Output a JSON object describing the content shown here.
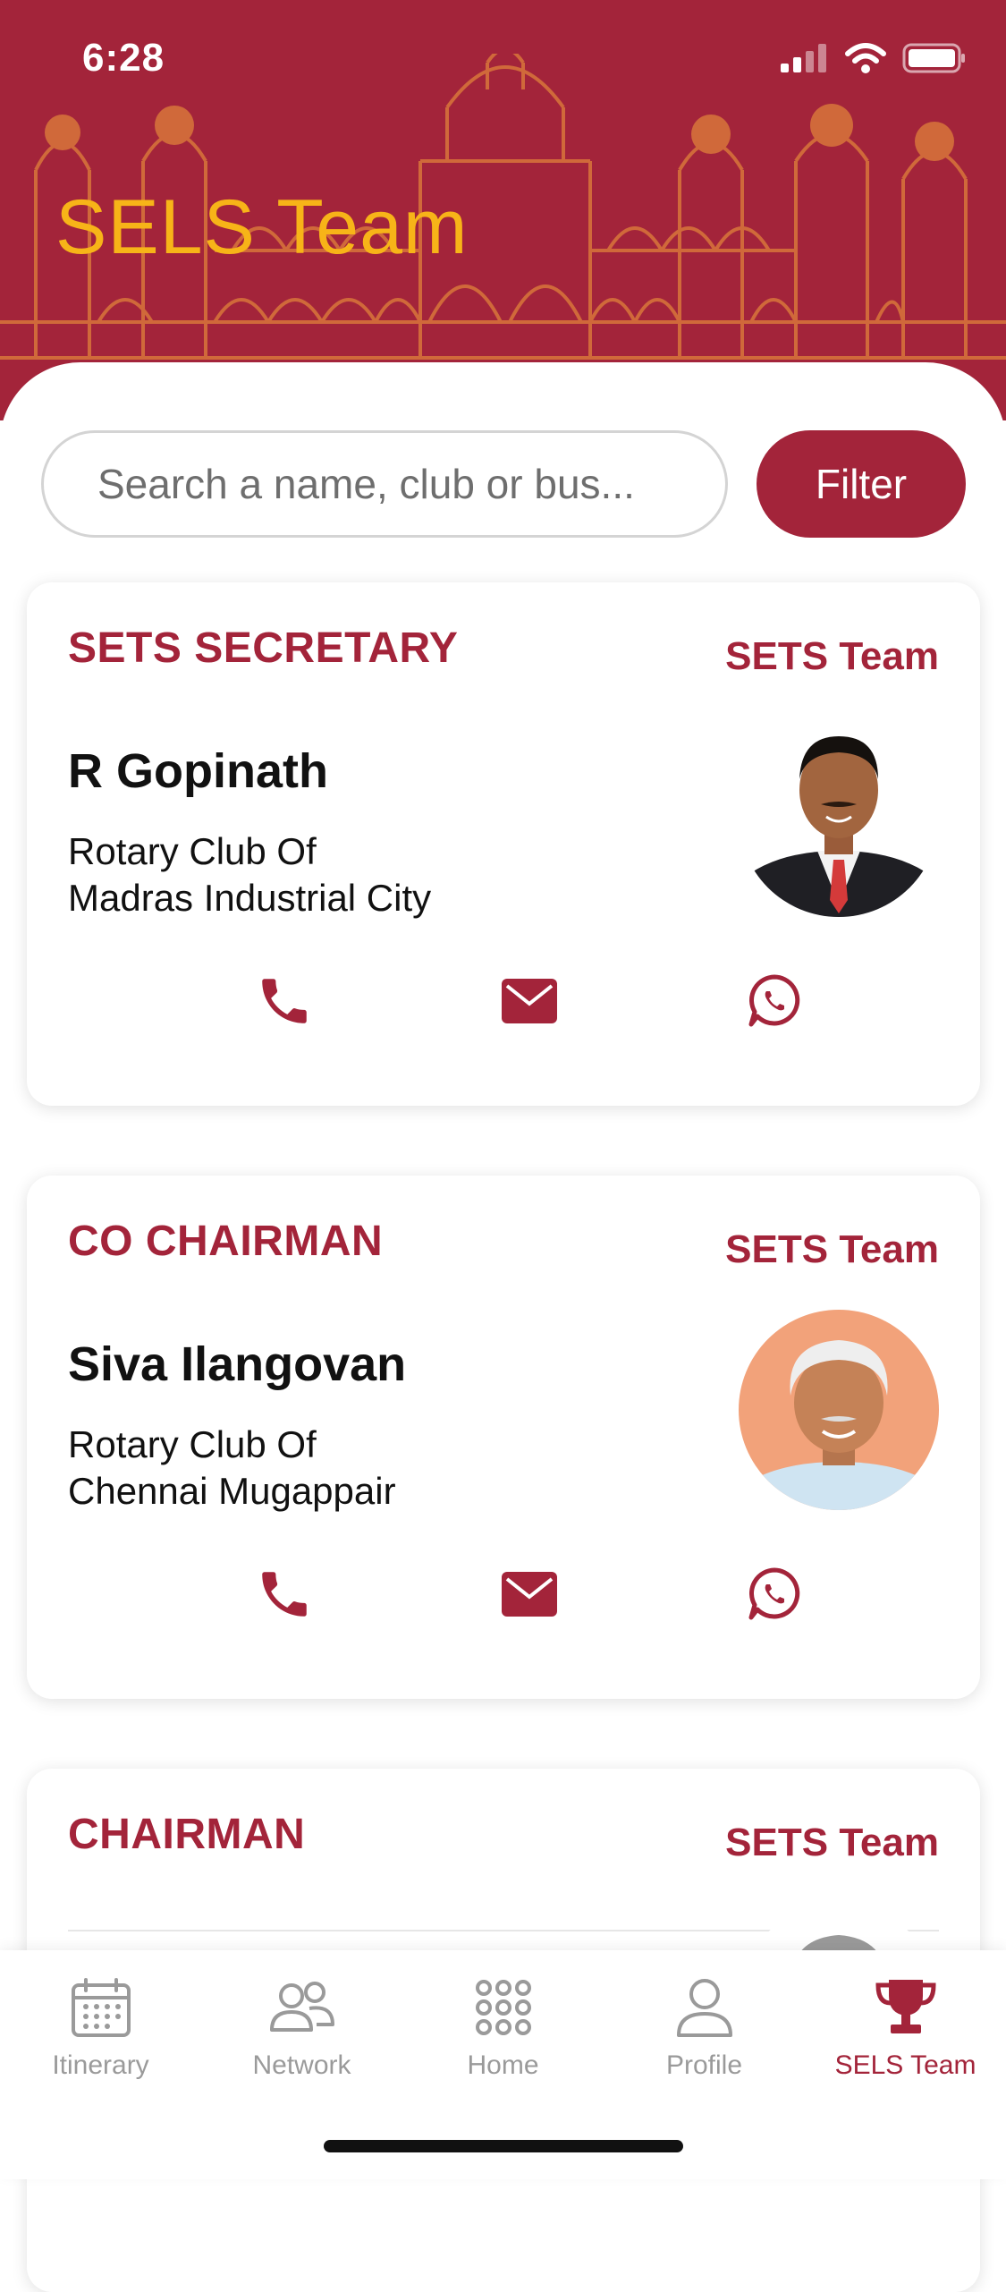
{
  "status_bar": {
    "time": "6:28"
  },
  "header": {
    "title": "SELS Team"
  },
  "search": {
    "placeholder": "Search a name, club or bus..."
  },
  "filter": {
    "label": "Filter"
  },
  "members": [
    {
      "role": "SETS SECRETARY",
      "team": "SETS Team",
      "name": "R Gopinath",
      "club_line1": "Rotary Club Of",
      "club_line2": "Madras Industrial City"
    },
    {
      "role": "CO CHAIRMAN",
      "team": "SETS Team",
      "name": "Siva Ilangovan",
      "club_line1": "Rotary Club Of",
      "club_line2": "Chennai Mugappair"
    },
    {
      "role": "CHAIRMAN",
      "team": "SETS Team"
    }
  ],
  "tabs": [
    {
      "label": "Itinerary",
      "icon": "calendar-icon",
      "active": false
    },
    {
      "label": "Network",
      "icon": "people-icon",
      "active": false
    },
    {
      "label": "Home",
      "icon": "grid-icon",
      "active": false
    },
    {
      "label": "Profile",
      "icon": "person-icon",
      "active": false
    },
    {
      "label": "SELS Team",
      "icon": "trophy-icon",
      "active": true
    }
  ],
  "colors": {
    "brand": "#a3243a",
    "title": "#f7b418",
    "inactive": "#9a9a9a"
  }
}
